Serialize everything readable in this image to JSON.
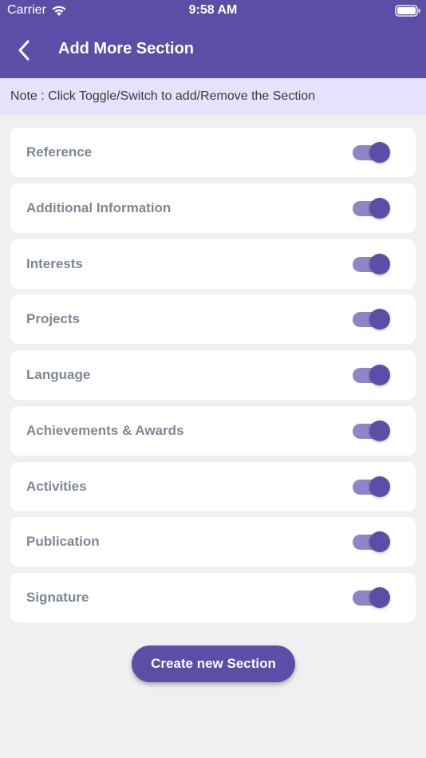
{
  "status_bar": {
    "carrier": "Carrier",
    "time": "9:58 AM"
  },
  "header": {
    "title": "Add More Section",
    "back_icon": "chevron-left-icon"
  },
  "note": "Note : Click Toggle/Switch to add/Remove the Section",
  "sections": [
    {
      "label": "Reference",
      "enabled": true
    },
    {
      "label": "Additional Information",
      "enabled": true
    },
    {
      "label": "Interests",
      "enabled": true
    },
    {
      "label": "Projects",
      "enabled": true
    },
    {
      "label": "Language",
      "enabled": true
    },
    {
      "label": "Achievements & Awards",
      "enabled": true
    },
    {
      "label": "Activities",
      "enabled": true
    },
    {
      "label": "Publication",
      "enabled": true
    },
    {
      "label": "Signature",
      "enabled": true
    }
  ],
  "create_button": "Create new Section",
  "colors": {
    "primary": "#5b4ea6",
    "note_bg": "#e5e3fc",
    "toggle_track": "#8f85c8"
  }
}
